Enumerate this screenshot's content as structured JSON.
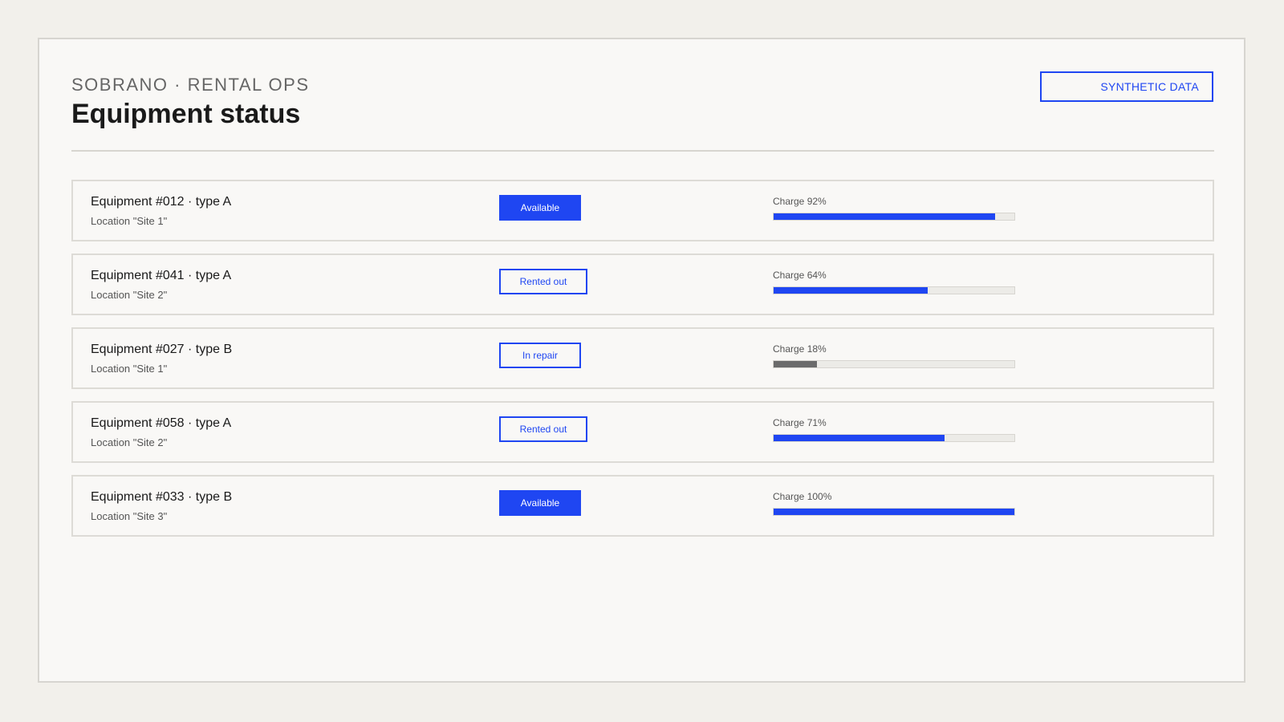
{
  "header": {
    "kicker": "SOBRANO · RENTAL OPS",
    "title": "Equipment status",
    "badge": "SYNTHETIC DATA"
  },
  "colors": {
    "accent": "#1f46f2",
    "low_charge": "#6b6b6b",
    "background": "#f2f0eb",
    "panel": "#f9f8f6"
  },
  "equipment": [
    {
      "name": "Equipment #012 · type A",
      "location": "Location \"Site 1\"",
      "status": "Available",
      "status_style": "solid",
      "charge_label": "Charge 92%",
      "charge": 0.92
    },
    {
      "name": "Equipment #041 · type A",
      "location": "Location \"Site 2\"",
      "status": "Rented out",
      "status_style": "outline",
      "charge_label": "Charge 64%",
      "charge": 0.64
    },
    {
      "name": "Equipment #027 · type B",
      "location": "Location \"Site 1\"",
      "status": "In repair",
      "status_style": "outline",
      "charge_label": "Charge 18%",
      "charge": 0.18
    },
    {
      "name": "Equipment #058 · type A",
      "location": "Location \"Site 2\"",
      "status": "Rented out",
      "status_style": "outline",
      "charge_label": "Charge 71%",
      "charge": 0.71
    },
    {
      "name": "Equipment #033 · type B",
      "location": "Location \"Site 3\"",
      "status": "Available",
      "status_style": "solid",
      "charge_label": "Charge 100%",
      "charge": 1.0
    }
  ]
}
